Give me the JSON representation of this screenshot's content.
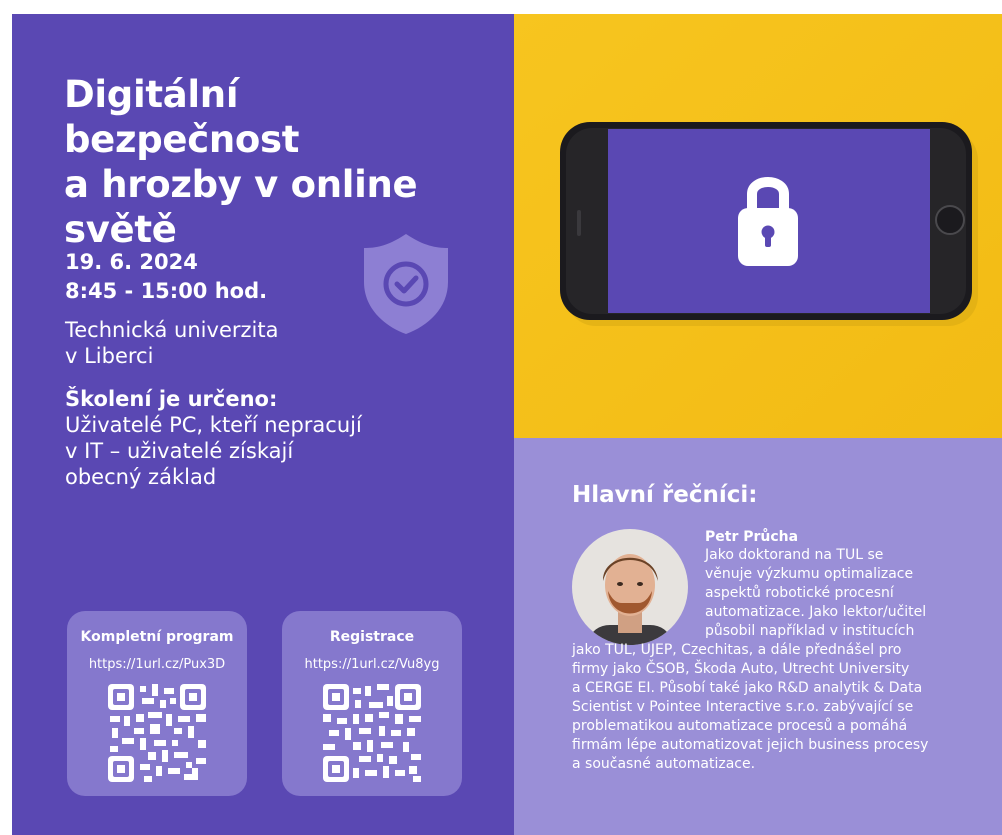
{
  "event": {
    "title_lines": [
      "Digitální bezpečnost",
      "a hrozby v online",
      "světě"
    ],
    "date": "19. 6. 2024",
    "time": "8:45 - 15:00 hod.",
    "place_lines": [
      "Technická univerzita",
      "v Liberci"
    ],
    "intended_heading": "Školení je určeno:",
    "intended_lines": [
      "Uživatelé PC, kteří nepracují",
      "v IT – uživatelé získají",
      "obecný základ"
    ]
  },
  "links": [
    {
      "title": "Kompletní program",
      "url": "https://1url.cz/Pux3D"
    },
    {
      "title": "Registrace",
      "url": "https://1url.cz/Vu8yg"
    }
  ],
  "speakers": {
    "heading": "Hlavní řečníci:",
    "name": "Petr Průcha",
    "bio_lines": [
      "Jako doktorand na TUL se",
      "věnuje výzkumu optimalizace",
      "aspektů robotické procesní",
      "automatizace. Jako lektor/učitel",
      "působil například v institucích",
      "jako TUL, UJEP, Czechitas, a dále přednášel pro",
      "firmy jako ČSOB, Škoda Auto, Utrecht University",
      "a CERGE EI. Působí také jako R&D analytik & Data",
      "Scientist v Pointee Interactive s.r.o. zabývající se",
      "problematikou automatizace procesů a pomáhá",
      "firmám lépe automatizovat jejich business procesy",
      "a současné automatizace."
    ]
  },
  "colors": {
    "left_panel": "#5a48b3",
    "photo_background": "#f5c21b",
    "speaker_panel": "#9a8fd7",
    "qr_card": "#8578cd"
  },
  "icons": [
    "shield-check-icon",
    "lock-icon",
    "qr-code-icon"
  ]
}
